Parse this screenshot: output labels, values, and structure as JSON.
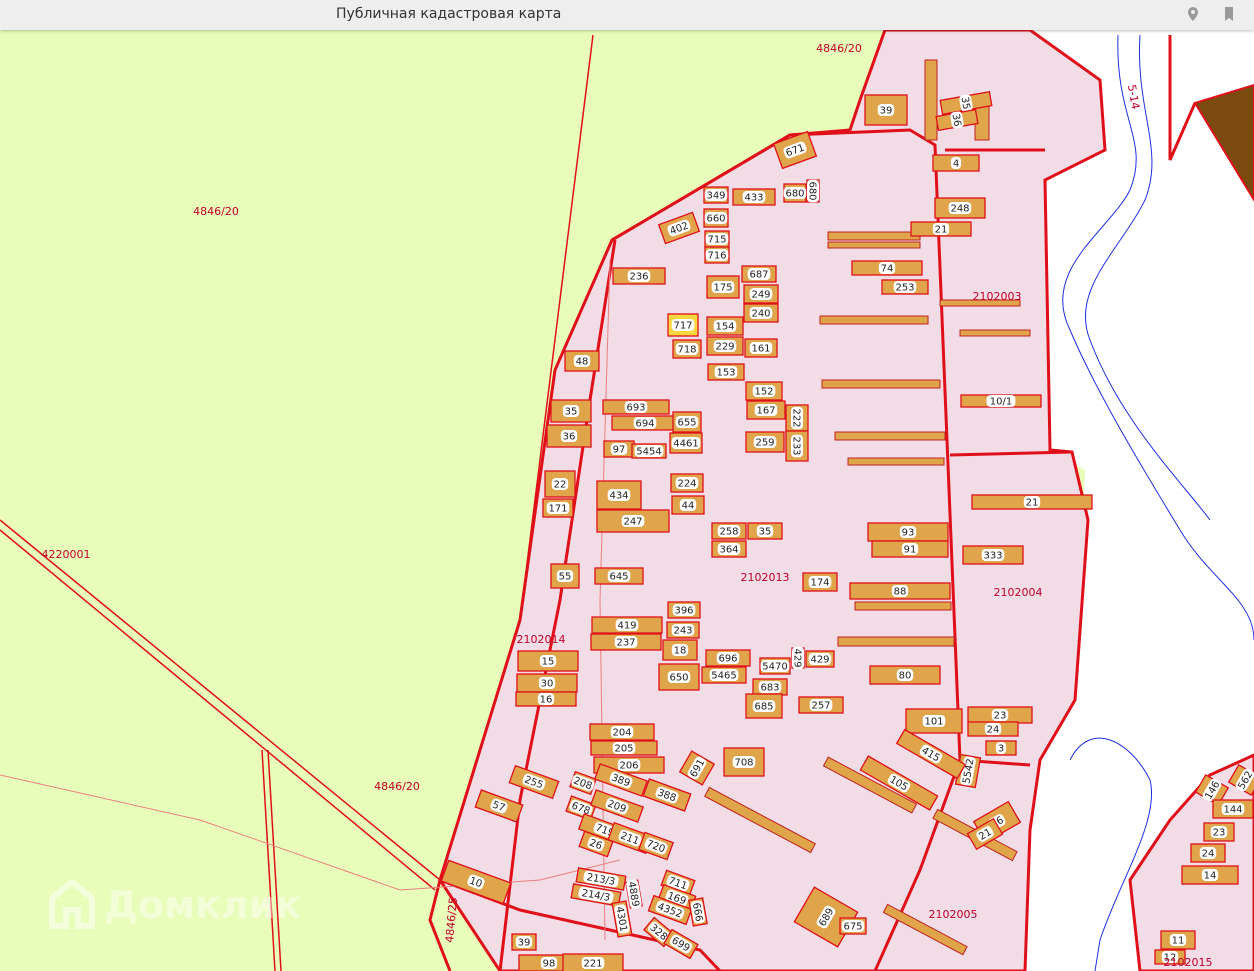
{
  "header": {
    "title": "Публичная кадастровая карта",
    "icons": [
      "location-pin-icon",
      "bookmark-icon"
    ]
  },
  "watermark": "Домклик",
  "colors": {
    "land": "#e9fdbb",
    "block": "#f2dde6",
    "plot": "#e0a44a",
    "border": "#e0101a",
    "water": "#2030e0",
    "selected": "#f7d840"
  },
  "block_labels": [
    "4846/20",
    "4846/20",
    "4846/20",
    "4220001",
    "2102003",
    "2102004",
    "2102013",
    "2102014",
    "2102005",
    "2102015",
    "5-14",
    "4846/25"
  ],
  "plots": [
    "39",
    "35",
    "36",
    "4",
    "671",
    "433",
    "680",
    "680",
    "349",
    "660",
    "715",
    "716",
    "402",
    "236",
    "687",
    "175",
    "249",
    "240",
    "717",
    "154",
    "718",
    "229",
    "161",
    "153",
    "48",
    "152",
    "167",
    "222",
    "233",
    "259",
    "35",
    "693",
    "694",
    "655",
    "36",
    "97",
    "5454",
    "4461",
    "22",
    "434",
    "224",
    "44",
    "171",
    "247",
    "258",
    "35",
    "364",
    "55",
    "645",
    "174",
    "396",
    "419",
    "243",
    "237",
    "18",
    "15",
    "696",
    "5470",
    "429",
    "429",
    "650",
    "5465",
    "30",
    "683",
    "16",
    "685",
    "257",
    "204",
    "205",
    "206",
    "691",
    "708",
    "255",
    "208",
    "389",
    "388",
    "678",
    "209",
    "57",
    "719",
    "211",
    "26",
    "720",
    "10",
    "213/3",
    "214/3",
    "4889",
    "711",
    "169",
    "4352",
    "666",
    "4301",
    "328",
    "699",
    "39",
    "98",
    "221",
    "689",
    "675",
    "5542",
    "26",
    "21",
    "23",
    "24",
    "3",
    "101",
    "415",
    "105",
    "80",
    "88",
    "93",
    "91",
    "333",
    "21",
    "10/1",
    "74",
    "253",
    "248",
    "21",
    "146",
    "562",
    "144",
    "23",
    "24",
    "14",
    "11",
    "12"
  ]
}
